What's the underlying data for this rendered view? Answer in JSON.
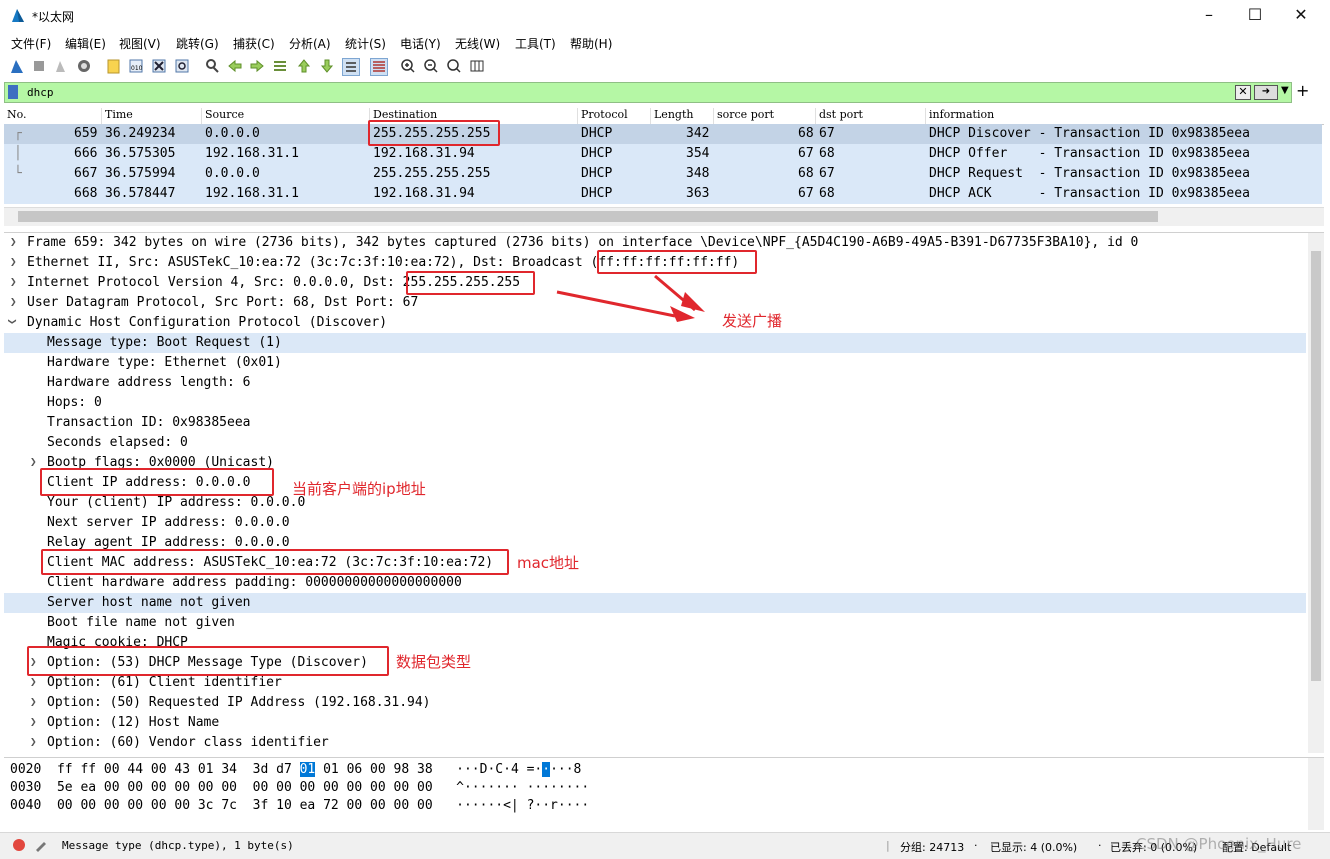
{
  "window": {
    "title": "*以太网"
  },
  "menu": [
    "文件(F)",
    "编辑(E)",
    "视图(V)",
    "跳转(G)",
    "捕获(C)",
    "分析(A)",
    "统计(S)",
    "电话(Y)",
    "无线(W)",
    "工具(T)",
    "帮助(H)"
  ],
  "filter": {
    "value": "dhcp"
  },
  "packet_list": {
    "columns": [
      "No.",
      "Time",
      "Source",
      "Destination",
      "Protocol",
      "Length",
      "sorce port",
      "dst port",
      "information"
    ],
    "rows": [
      {
        "no": "659",
        "time": "36.249234",
        "src": "0.0.0.0",
        "dst": "255.255.255.255",
        "proto": "DHCP",
        "len": "342",
        "sport": "68",
        "dport": "67",
        "info": "DHCP Discover - Transaction ID 0x98385eea"
      },
      {
        "no": "666",
        "time": "36.575305",
        "src": "192.168.31.1",
        "dst": "192.168.31.94",
        "proto": "DHCP",
        "len": "354",
        "sport": "67",
        "dport": "68",
        "info": "DHCP Offer    - Transaction ID 0x98385eea"
      },
      {
        "no": "667",
        "time": "36.575994",
        "src": "0.0.0.0",
        "dst": "255.255.255.255",
        "proto": "DHCP",
        "len": "348",
        "sport": "68",
        "dport": "67",
        "info": "DHCP Request  - Transaction ID 0x98385eea"
      },
      {
        "no": "668",
        "time": "36.578447",
        "src": "192.168.31.1",
        "dst": "192.168.31.94",
        "proto": "DHCP",
        "len": "363",
        "sport": "67",
        "dport": "68",
        "info": "DHCP ACK      - Transaction ID 0x98385eea"
      }
    ]
  },
  "details": {
    "lines": [
      "Frame 659: 342 bytes on wire (2736 bits), 342 bytes captured (2736 bits) on interface \\Device\\NPF_{A5D4C190-A6B9-49A5-B391-D67735F3BA10}, id 0",
      "Ethernet II, Src: ASUSTekC_10:ea:72 (3c:7c:3f:10:ea:72), Dst: Broadcast (ff:ff:ff:ff:ff:ff)",
      "Internet Protocol Version 4, Src: 0.0.0.0, Dst: 255.255.255.255",
      "User Datagram Protocol, Src Port: 68, Dst Port: 67",
      "Dynamic Host Configuration Protocol (Discover)",
      "Message type: Boot Request (1)",
      "Hardware type: Ethernet (0x01)",
      "Hardware address length: 6",
      "Hops: 0",
      "Transaction ID: 0x98385eea",
      "Seconds elapsed: 0",
      "Bootp flags: 0x0000 (Unicast)",
      "Client IP address: 0.0.0.0",
      "Your (client) IP address: 0.0.0.0",
      "Next server IP address: 0.0.0.0",
      "Relay agent IP address: 0.0.0.0",
      "Client MAC address: ASUSTekC_10:ea:72 (3c:7c:3f:10:ea:72)",
      "Client hardware address padding: 00000000000000000000",
      "Server host name not given",
      "Boot file name not given",
      "Magic cookie: DHCP",
      "Option: (53) DHCP Message Type (Discover)",
      "Option: (61) Client identifier",
      "Option: (50) Requested IP Address (192.168.31.94)",
      "Option: (12) Host Name",
      "Option: (60) Vendor class identifier"
    ]
  },
  "hex": {
    "rows": [
      {
        "offset": "0020",
        "bytes_a": "ff ff 00 44 00 43 01 34  3d d7 ",
        "hl": "01",
        "bytes_b": " 01 06 00 98 38",
        "ascii_a": "···D·C·4 =·",
        "ascii_hl": "·",
        "ascii_b": "···8"
      },
      {
        "offset": "0030",
        "bytes_a": "5e ea 00 00 00 00 00 00  00 00 00 00 00 00 00 00",
        "hl": "",
        "bytes_b": "",
        "ascii_a": "^······· ········",
        "ascii_hl": "",
        "ascii_b": ""
      },
      {
        "offset": "0040",
        "bytes_a": "00 00 00 00 00 00 3c 7c  3f 10 ea 72 00 00 00 00",
        "hl": "",
        "bytes_b": "",
        "ascii_a": "······<| ?··r····",
        "ascii_hl": "",
        "ascii_b": ""
      }
    ]
  },
  "status": {
    "field": "Message type (dhcp.type), 1 byte(s)",
    "groups": "分组: 24713",
    "displayed": "已显示: 4 (0.0%)",
    "dropped": "已丢弃: 0 (0.0%)",
    "profile": "配置: Default",
    "watermark": "CSDN @Phoenix_Hure"
  },
  "annotations": {
    "broadcast": "发送广播",
    "client_ip": "当前客户端的ip地址",
    "mac": "mac地址",
    "pkt_type": "数据包类型"
  },
  "colors": {
    "annotation": "#e0272d",
    "filter_bg": "#b5f7a5",
    "row_bg": "#dae8f8",
    "row_sel": "#c3d3e6"
  }
}
